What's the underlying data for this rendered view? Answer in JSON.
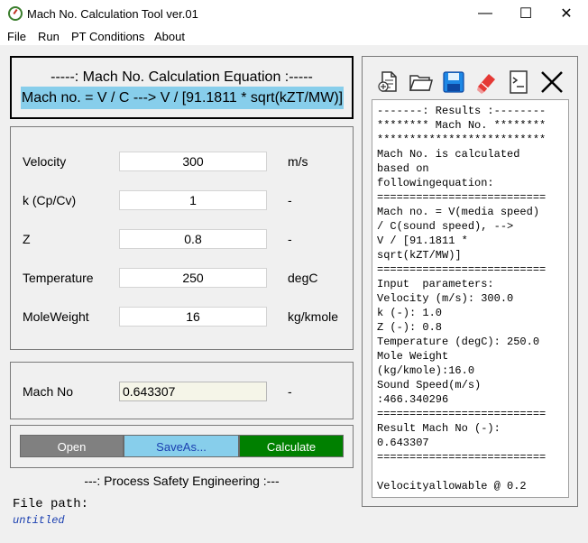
{
  "window": {
    "title": "Mach No. Calculation Tool ver.01",
    "minimize_glyph": "—",
    "maximize_glyph": "☐",
    "close_glyph": "✕"
  },
  "menu": [
    "File",
    "Run",
    "PT Conditions",
    "About"
  ],
  "equation": {
    "heading": "-----: Mach No. Calculation Equation :-----",
    "formula": "Mach no. = V / C ---> V / [91.1811 * sqrt(kZT/MW)]",
    "formula_bg": "#87ceeb"
  },
  "inputs": [
    {
      "label": "Velocity",
      "value": "300",
      "unit": "m/s"
    },
    {
      "label": "k (Cp/Cv)",
      "value": "1",
      "unit": "-"
    },
    {
      "label": "Z",
      "value": "0.8",
      "unit": "-"
    },
    {
      "label": "Temperature",
      "value": "250",
      "unit": "degC"
    },
    {
      "label": "MoleWeight",
      "value": "16",
      "unit": "kg/kmole"
    }
  ],
  "result": {
    "label": "Mach No",
    "value": "0.643307",
    "unit": "-"
  },
  "buttons": {
    "open": "Open",
    "saveas": "SaveAs...",
    "calculate": "Calculate",
    "open_color": "#808080",
    "saveas_color": "#87ceeb",
    "calculate_color": "#008000"
  },
  "footer": "---: Process Safety Engineering :---",
  "file_path": {
    "label": "File path:",
    "value": "untitled"
  },
  "toolbar_icons": [
    "new-document-icon",
    "open-folder-icon",
    "save-disk-icon",
    "eraser-icon",
    "terminal-icon",
    "close-x-icon"
  ],
  "results_lines": [
    "-------: Results :--------",
    "******** Mach No. ********",
    "**************************",
    "Mach No. is calculated",
    "based on",
    "followingequation:",
    "==========================",
    "Mach no. = V(media speed)",
    "/ C(sound speed), -->",
    "V / [91.1811 *",
    "sqrt(kZT/MW)]",
    "==========================",
    "Input  parameters:",
    "Velocity (m/s): 300.0",
    "k (-): 1.0",
    "Z (-): 0.8",
    "Temperature (degC): 250.0",
    "Mole Weight",
    "(kg/kmole):16.0",
    "Sound Speed(m/s)",
    ":466.340296",
    "==========================",
    "Result Mach No (-):",
    "0.643307",
    "==========================",
    "",
    "Velocityallowable @ 0.2"
  ]
}
